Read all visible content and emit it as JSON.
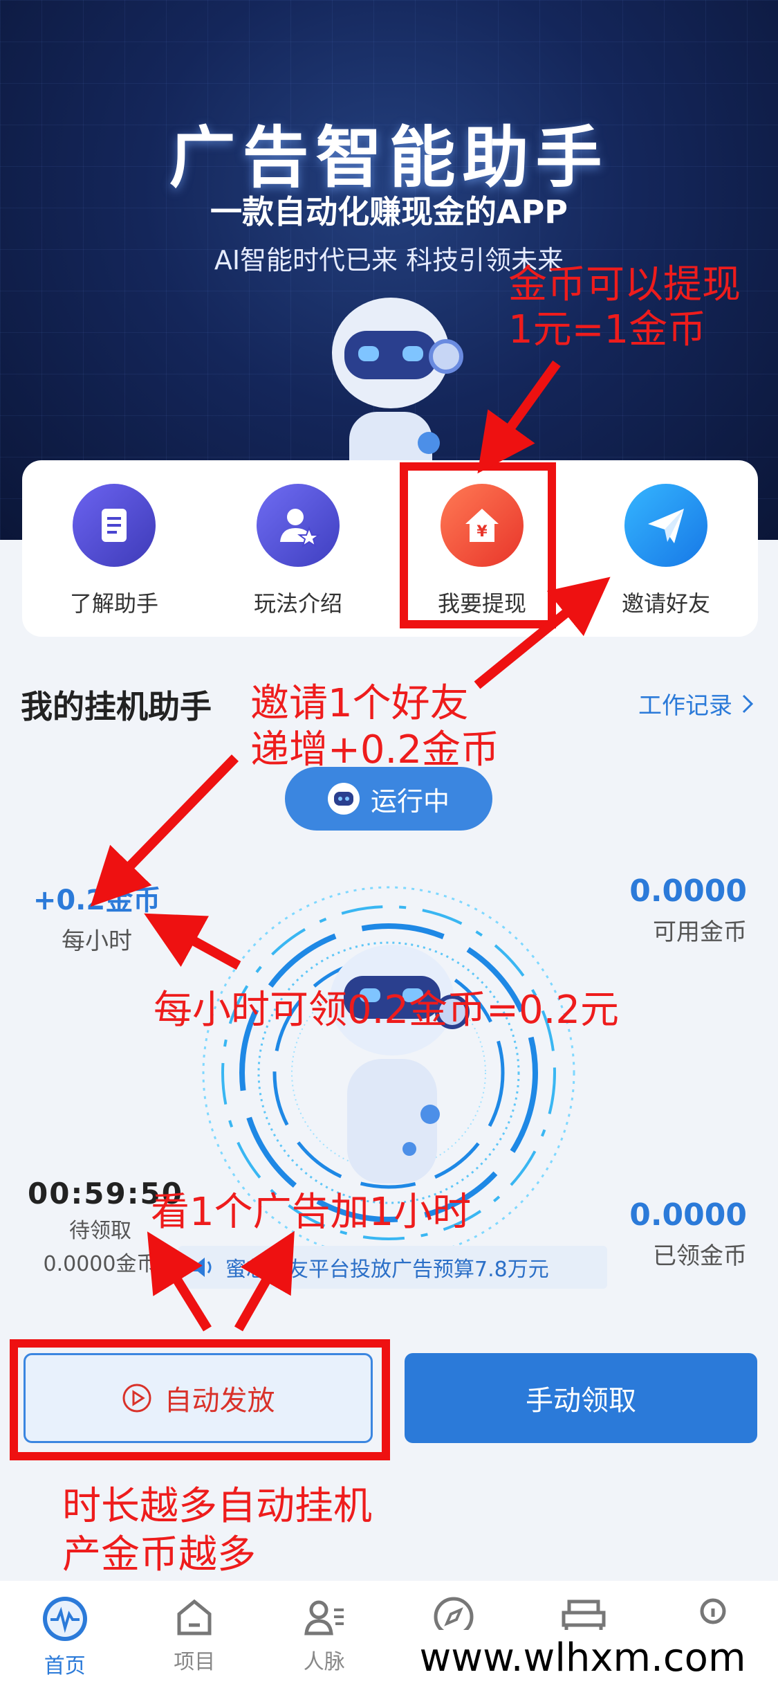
{
  "hero": {
    "title": "广告智能助手",
    "subtitle": "一款自动化赚现金的APP",
    "tagline": "AI智能时代已来 科技引领未来"
  },
  "actions": [
    {
      "label": "了解助手",
      "icon": "document-icon"
    },
    {
      "label": "玩法介绍",
      "icon": "user-star-icon"
    },
    {
      "label": "我要提现",
      "icon": "yen-house-icon"
    },
    {
      "label": "邀请好友",
      "icon": "paper-plane-icon"
    }
  ],
  "section": {
    "title": "我的挂机助手",
    "work_log": "工作记录"
  },
  "status_pill": "运行中",
  "stats": {
    "rate_value": "+0.2金币",
    "rate_label": "每小时",
    "available_value": "0.0000",
    "available_label": "可用金币",
    "timer_value": "00:59:50",
    "timer_label": "待领取",
    "pending_coins": "0.0000金币",
    "claimed_value": "0.0000",
    "claimed_label": "已领金币"
  },
  "ticker": "蜜芯伙友平台投放广告预算7.8万元",
  "buttons": {
    "auto": "自动发放",
    "manual": "手动领取"
  },
  "tabbar": [
    {
      "label": "首页",
      "icon": "pulse-icon",
      "active": true
    },
    {
      "label": "项目",
      "icon": "home-icon",
      "active": false
    },
    {
      "label": "人脉",
      "icon": "contacts-icon",
      "active": false
    },
    {
      "label": "",
      "icon": "compass-icon",
      "active": false
    },
    {
      "label": "",
      "icon": "bed-icon",
      "active": false
    },
    {
      "label": "",
      "icon": "profile-icon",
      "active": false
    }
  ],
  "annotations": {
    "withdraw_note_1": "金币可以提现",
    "withdraw_note_2": "1元=1金币",
    "invite_note_1": "邀请1个好友",
    "invite_note_2": "递增+0.2金币",
    "hourly_note": "每小时可领0.2金币=0.2元",
    "ad_note": "看1个广告加1小时",
    "auto_note_1": "时长越多自动挂机",
    "auto_note_2": "产金币越多"
  },
  "watermark": "www.wlhxm.com",
  "colors": {
    "primary": "#2b7ad9",
    "annotation_red": "#ee1c1c",
    "hero_bg": "#14265a"
  }
}
